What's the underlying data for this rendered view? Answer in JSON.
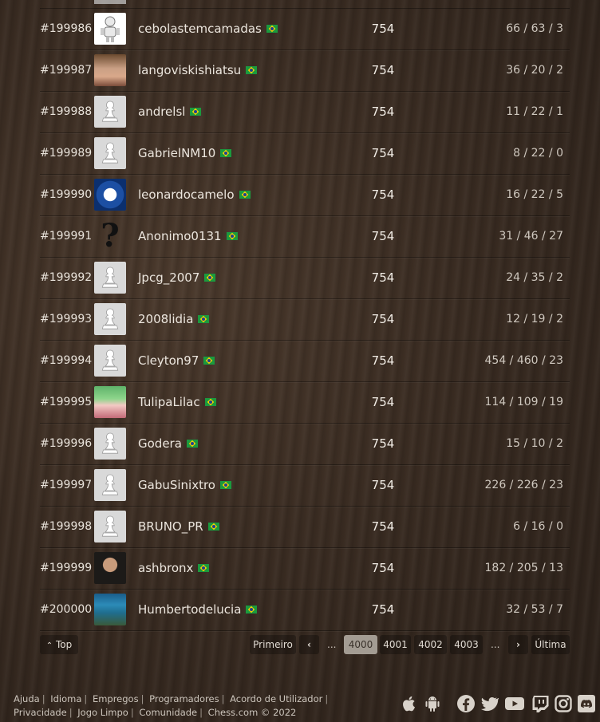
{
  "rows": [
    {
      "rank": "#199986",
      "username": "cebolastemcamadas",
      "rating": "754",
      "stats": "66 / 63 / 3",
      "avatar": "robot"
    },
    {
      "rank": "#199987",
      "username": "langoviskishiatsu",
      "rating": "754",
      "stats": "36 / 20 / 2",
      "avatar": "kid"
    },
    {
      "rank": "#199988",
      "username": "andrelsl",
      "rating": "754",
      "stats": "11 / 22 / 1",
      "avatar": "pawn"
    },
    {
      "rank": "#199989",
      "username": "GabrielNM10",
      "rating": "754",
      "stats": "8 / 22 / 0",
      "avatar": "pawn"
    },
    {
      "rank": "#199990",
      "username": "leonardocamelo",
      "rating": "754",
      "stats": "16 / 22 / 5",
      "avatar": "cruz"
    },
    {
      "rank": "#199991",
      "username": "Anonimo0131",
      "rating": "754",
      "stats": "31 / 46 / 27",
      "avatar": "question"
    },
    {
      "rank": "#199992",
      "username": "Jpcg_2007",
      "rating": "754",
      "stats": "24 / 35 / 2",
      "avatar": "pawn"
    },
    {
      "rank": "#199993",
      "username": "2008lidia",
      "rating": "754",
      "stats": "12 / 19 / 2",
      "avatar": "pawn"
    },
    {
      "rank": "#199994",
      "username": "Cleyton97",
      "rating": "754",
      "stats": "454 / 460 / 23",
      "avatar": "pawn"
    },
    {
      "rank": "#199995",
      "username": "TulipaLilac",
      "rating": "754",
      "stats": "114 / 109 / 19",
      "avatar": "anime"
    },
    {
      "rank": "#199996",
      "username": "Godera",
      "rating": "754",
      "stats": "15 / 10 / 2",
      "avatar": "pawn"
    },
    {
      "rank": "#199997",
      "username": "GabuSinixtro",
      "rating": "754",
      "stats": "226 / 226 / 23",
      "avatar": "pawn"
    },
    {
      "rank": "#199998",
      "username": "BRUNO_PR",
      "rating": "754",
      "stats": "6 / 16 / 0",
      "avatar": "pawn"
    },
    {
      "rank": "#199999",
      "username": "ashbronx",
      "rating": "754",
      "stats": "182 / 205 / 13",
      "avatar": "man"
    },
    {
      "rank": "#200000",
      "username": "Humbertodelucia",
      "rating": "754",
      "stats": "32 / 53 / 7",
      "avatar": "sea"
    }
  ],
  "pagination": {
    "top_label": "Top",
    "first_label": "Primeiro",
    "last_label": "Última",
    "ellipsis": "...",
    "pages": [
      "4000",
      "4001",
      "4002",
      "4003"
    ],
    "current_page": "4000"
  },
  "footer": {
    "links": [
      "Ajuda",
      "Idioma",
      "Empregos",
      "Programadores",
      "Acordo de Utilizador",
      "Privacidade",
      "Jogo Limpo",
      "Comunidade"
    ],
    "copyright": "Chess.com © 2022"
  },
  "icons": {
    "app_icons": [
      "apple-icon",
      "android-icon"
    ],
    "social_icons": [
      "facebook-icon",
      "twitter-icon",
      "youtube-icon",
      "twitch-icon",
      "instagram-icon",
      "discord-icon"
    ]
  },
  "colors": {
    "flag_green": "#1b9a3e",
    "flag_yellow": "#f5d000",
    "flag_blue": "#1f3f93",
    "active_page_bg": "#a39c93"
  }
}
